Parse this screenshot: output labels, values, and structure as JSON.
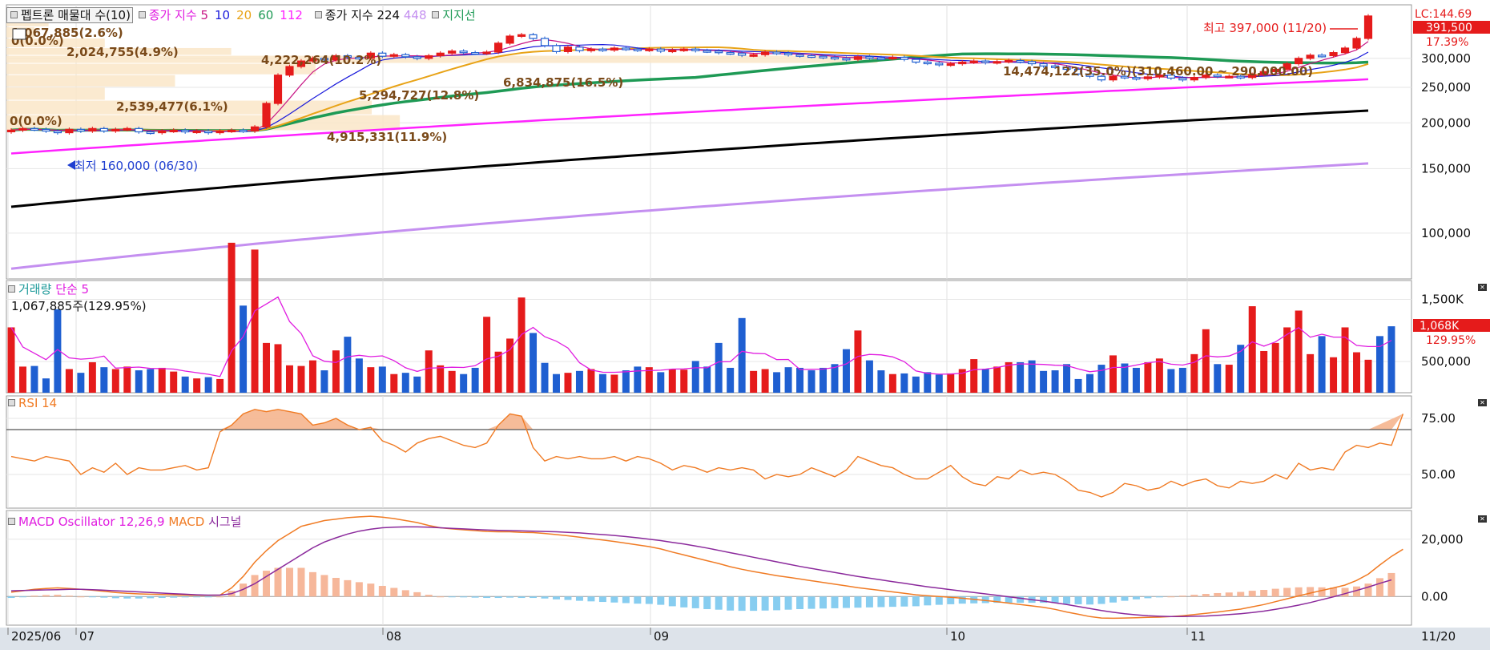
{
  "main_legend": {
    "volume_profile": "펩트론 매물대 수(10)",
    "ma_label": "종가 지수",
    "ma_periods": [
      "5",
      "10",
      "20",
      "60",
      "112"
    ],
    "ma_colors": [
      "#c71585",
      "#1a1adb",
      "#e8a317",
      "#1e9a55",
      "#ff22ff"
    ],
    "ma224_label": "종가 지수 224",
    "ma448_label": "448",
    "support_label": "지지선"
  },
  "price_axis": {
    "ticks": [
      "300,000",
      "250,000",
      "200,000",
      "150,000",
      "100,000"
    ],
    "lc_label": "LC:144.69",
    "current_price": "391,500",
    "change_pct": "17.39%"
  },
  "annotations": {
    "high": "최고 397,000 (11/20)",
    "low": "최저 160,000 (06/30)",
    "profile_labels": [
      "1,067,885(2.6%)",
      "0(0.0%)",
      "2,024,755(4.9%)",
      "4,222,264(10.2%)",
      "2,539,477(6.1%)",
      "5,294,727(12.8%)",
      "6,834,875(16.5%)",
      "14,474,122(35.0%)(310,460.00 ~ 290,000.00)",
      "0(0.0%)",
      "4,915,331(11.9%)"
    ]
  },
  "volume_panel": {
    "legend_name": "거래량",
    "legend_ma": "단순 5",
    "info": "1,067,885주(129.95%)",
    "ticks": [
      "1,500K",
      "500,000"
    ],
    "current_value": "1,068K",
    "current_pct": "129.95%"
  },
  "rsi_panel": {
    "legend": "RSI 14",
    "ticks": [
      "75.00",
      "50.00"
    ]
  },
  "macd_panel": {
    "legend_osc": "MACD Oscillator 12,26,9",
    "legend_macd": "MACD",
    "legend_signal": "시그널",
    "ticks": [
      "20,000",
      "0.00"
    ]
  },
  "x_axis": {
    "labels": [
      "2025/06",
      "07",
      "08",
      "09",
      "10",
      "11"
    ],
    "end_label": "11/20"
  },
  "colors": {
    "up": "#e51b1b",
    "down": "#1f5fd1",
    "ma224": "#000000",
    "ma448": "#c48ff0",
    "rsi": "#f07b24",
    "macd": "#f07b24",
    "signal": "#8b2a9c",
    "osc_pos": "#f6b79a",
    "osc_neg": "#87cdf0",
    "profile": "#fae6c8"
  },
  "chart_data": [
    {
      "type": "candlestick",
      "title": "펩트론",
      "x": [
        "2025/06",
        "07",
        "08",
        "09",
        "10",
        "11",
        "11/20"
      ],
      "ylim": [
        75000,
        420000
      ],
      "log_scale": true,
      "close": [
        191000,
        193000,
        192000,
        190000,
        188000,
        192000,
        190000,
        193000,
        190000,
        192000,
        193000,
        189000,
        188000,
        190000,
        191000,
        189000,
        190000,
        188000,
        190000,
        191000,
        190000,
        195000,
        226000,
        270000,
        285000,
        295000,
        300000,
        297000,
        305000,
        302000,
        300000,
        310000,
        304000,
        307000,
        303000,
        300000,
        305000,
        310000,
        314000,
        311000,
        310000,
        312000,
        330000,
        345000,
        348000,
        340000,
        325000,
        313000,
        322000,
        315000,
        318000,
        316000,
        320000,
        318000,
        316000,
        318000,
        314000,
        316000,
        318000,
        315000,
        314000,
        311000,
        310000,
        306000,
        307000,
        312000,
        310000,
        307000,
        305000,
        304000,
        302000,
        300000,
        298000,
        303000,
        301000,
        300000,
        302000,
        298000,
        293000,
        291000,
        288000,
        290000,
        293000,
        295000,
        292000,
        294000,
        296000,
        294000,
        290000,
        286000,
        284000,
        280000,
        272000,
        268000,
        262000,
        268000,
        266000,
        264000,
        267000,
        270000,
        265000,
        262000,
        266000,
        270000,
        268000,
        268000,
        266000,
        271000,
        276000,
        280000,
        290000,
        300000,
        306000,
        305000,
        311000,
        320000,
        340000,
        391500
      ],
      "high": "397,000 (11/20)",
      "low": "160,000 (06/30)",
      "moving_averages": [
        "5",
        "10",
        "20",
        "60",
        "112",
        "224",
        "448"
      ]
    },
    {
      "type": "bar",
      "title": "거래량",
      "ylim": [
        0,
        1700000
      ],
      "values": [
        1050000,
        420000,
        430000,
        230000,
        1340000,
        380000,
        320000,
        490000,
        410000,
        380000,
        420000,
        360000,
        380000,
        400000,
        340000,
        260000,
        230000,
        250000,
        220000,
        2410000,
        1400000,
        2300000,
        800000,
        780000,
        440000,
        430000,
        520000,
        360000,
        680000,
        900000,
        550000,
        410000,
        420000,
        300000,
        320000,
        260000,
        680000,
        440000,
        350000,
        300000,
        400000,
        1220000,
        660000,
        870000,
        1530000,
        960000,
        480000,
        300000,
        320000,
        350000,
        380000,
        300000,
        290000,
        360000,
        420000,
        410000,
        330000,
        380000,
        370000,
        510000,
        420000,
        800000,
        400000,
        1200000,
        350000,
        380000,
        330000,
        410000,
        400000,
        360000,
        400000,
        460000,
        700000,
        1000000,
        520000,
        360000,
        300000,
        310000,
        260000,
        330000,
        290000,
        310000,
        380000,
        540000,
        380000,
        420000,
        490000,
        490000,
        520000,
        350000,
        360000,
        460000,
        220000,
        300000,
        450000,
        600000,
        470000,
        400000,
        490000,
        550000,
        380000,
        400000,
        620000,
        1020000,
        460000,
        450000,
        770000,
        1390000,
        670000,
        800000,
        1050000,
        1320000,
        620000,
        910000,
        570000,
        1050000,
        650000,
        530000,
        910000,
        1067885
      ],
      "current": "1,067,885주(129.95%)"
    },
    {
      "type": "line",
      "title": "RSI 14",
      "ylim": [
        35,
        85
      ],
      "values": [
        58,
        57,
        56,
        58,
        57,
        56,
        50,
        53,
        51,
        55,
        50,
        53,
        52,
        52,
        53,
        54,
        52,
        53,
        69,
        72,
        77,
        79,
        78,
        79,
        78,
        77,
        72,
        73,
        75,
        72,
        70,
        71,
        65,
        63,
        60,
        64,
        66,
        67,
        65,
        63,
        62,
        64,
        72,
        77,
        76,
        62,
        56,
        58,
        57,
        58,
        57,
        57,
        58,
        56,
        58,
        57,
        55,
        52,
        54,
        53,
        51,
        53,
        52,
        53,
        52,
        48,
        50,
        49,
        50,
        53,
        51,
        49,
        52,
        58,
        56,
        54,
        53,
        50,
        48,
        48,
        51,
        54,
        49,
        46,
        45,
        49,
        48,
        52,
        50,
        51,
        50,
        47,
        43,
        42,
        40,
        42,
        46,
        45,
        43,
        44,
        47,
        45,
        47,
        48,
        45,
        44,
        47,
        46,
        47,
        50,
        48,
        55,
        52,
        53,
        52,
        60,
        63,
        62,
        64,
        63,
        77
      ],
      "ref_line": 70
    },
    {
      "type": "line",
      "title": "MACD Oscillator 12,26,9",
      "ylim": [
        -10000,
        30000
      ],
      "series": [
        {
          "name": "MACD",
          "values": [
            1500,
            2000,
            2500,
            2800,
            3000,
            2800,
            2500,
            2200,
            1800,
            1400,
            1100,
            900,
            800,
            700,
            600,
            500,
            400,
            400,
            500,
            3000,
            7000,
            12000,
            16000,
            19500,
            22000,
            24500,
            25500,
            26500,
            27000,
            27500,
            27800,
            28000,
            27700,
            27200,
            26500,
            25800,
            24800,
            24000,
            23600,
            23300,
            23000,
            22700,
            22600,
            22600,
            22400,
            22300,
            22000,
            21600,
            21200,
            20700,
            20200,
            19700,
            19200,
            18600,
            18000,
            17400,
            16600,
            15500,
            14500,
            13500,
            12500,
            11500,
            10400,
            9500,
            8700,
            8000,
            7300,
            6700,
            6100,
            5500,
            4900,
            4300,
            3700,
            3100,
            2600,
            2100,
            1600,
            1100,
            600,
            300,
            0,
            -300,
            -600,
            -1000,
            -1400,
            -1800,
            -2300,
            -2800,
            -3300,
            -3800,
            -4500,
            -5400,
            -6200,
            -7000,
            -7500,
            -7600,
            -7500,
            -7400,
            -7300,
            -7200,
            -7000,
            -6700,
            -6300,
            -5900,
            -5400,
            -4900,
            -4400,
            -3600,
            -2800,
            -1800,
            -800,
            200,
            1200,
            2100,
            3000,
            4000,
            5600,
            7800,
            11000,
            14000,
            16500
          ]
        },
        {
          "name": "시그널",
          "values": [
            2000,
            2100,
            2200,
            2300,
            2400,
            2500,
            2500,
            2400,
            2200,
            2000,
            1800,
            1600,
            1400,
            1200,
            1000,
            800,
            600,
            500,
            500,
            1000,
            2500,
            4500,
            7000,
            9500,
            12000,
            14500,
            17000,
            19000,
            20500,
            21800,
            22800,
            23500,
            24000,
            24200,
            24300,
            24300,
            24200,
            24000,
            23800,
            23600,
            23400,
            23200,
            23100,
            23000,
            22900,
            22800,
            22700,
            22600,
            22400,
            22200,
            21900,
            21600,
            21300,
            20900,
            20500,
            20000,
            19500,
            18900,
            18300,
            17600,
            16900,
            16100,
            15300,
            14500,
            13700,
            12900,
            12100,
            11300,
            10500,
            9800,
            9100,
            8400,
            7700,
            7000,
            6400,
            5800,
            5200,
            4600,
            4000,
            3400,
            2900,
            2400,
            1900,
            1400,
            900,
            400,
            -100,
            -600,
            -1100,
            -1600,
            -2200,
            -2800,
            -3500,
            -4200,
            -4900,
            -5500,
            -6000,
            -6400,
            -6700,
            -6900,
            -7000,
            -7000,
            -6900,
            -6800,
            -6600,
            -6300,
            -6000,
            -5600,
            -5100,
            -4500,
            -3800,
            -3000,
            -2100,
            -1100,
            -100,
            1000,
            2100,
            3300,
            4600,
            5800
          ]
        }
      ]
    }
  ]
}
